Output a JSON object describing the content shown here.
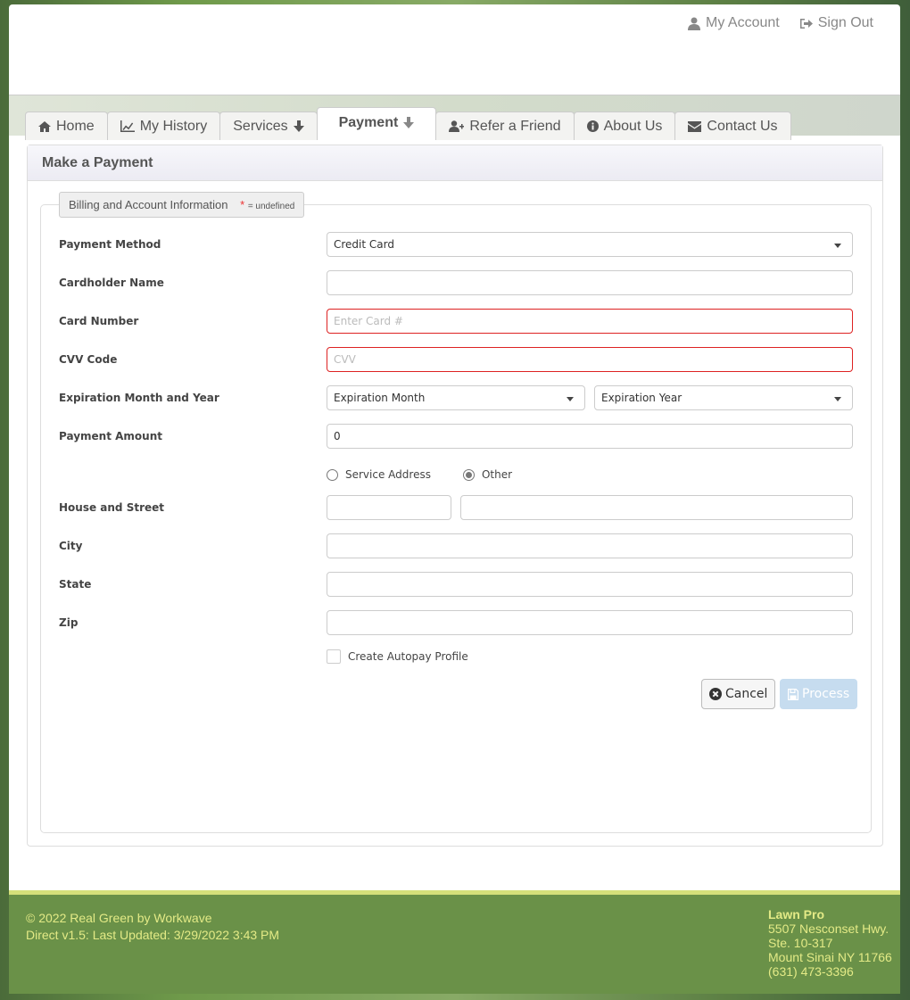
{
  "header": {
    "my_account": "My Account",
    "sign_out": "Sign Out"
  },
  "nav": {
    "tabs": [
      {
        "label": "Home",
        "icon": "home-icon"
      },
      {
        "label": "My History",
        "icon": "line-chart-icon"
      },
      {
        "label": "Services",
        "icon": "arrow-down-icon"
      },
      {
        "label": "Payment",
        "icon": "arrow-down-icon",
        "active": true
      },
      {
        "label": "Refer a Friend",
        "icon": "user-plus-icon"
      },
      {
        "label": "About Us",
        "icon": "info-circle-icon"
      },
      {
        "label": "Contact Us",
        "icon": "envelope-icon"
      }
    ]
  },
  "panel": {
    "title": "Make a Payment",
    "legend": "Billing and Account Information",
    "legend_star": "*",
    "legend_note": "= undefined"
  },
  "form": {
    "payment_method": {
      "label": "Payment Method",
      "value": "Credit Card"
    },
    "cardholder_name": {
      "label": "Cardholder Name",
      "value": ""
    },
    "card_number": {
      "label": "Card Number",
      "placeholder": "Enter Card #"
    },
    "cvv": {
      "label": "CVV Code",
      "placeholder": "CVV"
    },
    "expiration": {
      "label": "Expiration Month and Year",
      "month": "Expiration Month",
      "year": "Expiration Year"
    },
    "payment_amount": {
      "label": "Payment Amount",
      "value": "0"
    },
    "address_option": {
      "service_address": "Service Address",
      "other": "Other",
      "selected": "Other"
    },
    "house_street": {
      "label": "House and Street",
      "house": "",
      "street": ""
    },
    "city": {
      "label": "City",
      "value": ""
    },
    "state": {
      "label": "State",
      "value": ""
    },
    "zip": {
      "label": "Zip",
      "value": ""
    },
    "autopay": {
      "label": "Create Autopay Profile",
      "checked": false
    },
    "cancel": "Cancel",
    "process": "Process"
  },
  "footer": {
    "copyright": "© 2022 Real Green by Workwave",
    "version": "Direct v1.5: Last Updated: 3/29/2022 3:43 PM",
    "company": "Lawn Pro",
    "address1": "5507 Nesconset Hwy.",
    "address2": "Ste. 10-317",
    "city_line": "Mount Sinai NY 11766",
    "phone": "(631) 473-3396"
  },
  "colors": {
    "footer_bg": "#6a9148",
    "footer_text": "#e3ea86",
    "footer_stripe": "#d5e07a",
    "error_border": "#d22222",
    "process_disabled": "#c6dcef"
  }
}
